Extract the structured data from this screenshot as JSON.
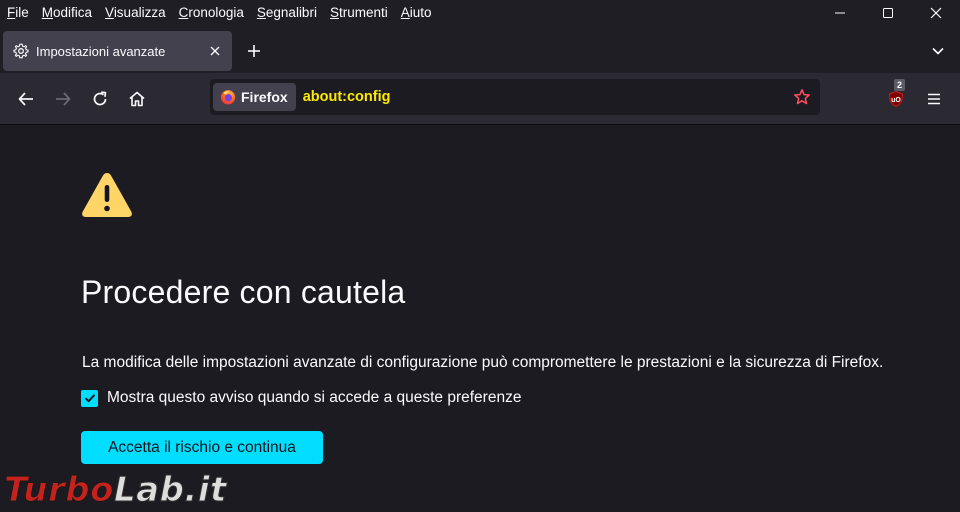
{
  "menubar": {
    "items": [
      {
        "first": "F",
        "rest": "ile"
      },
      {
        "first": "M",
        "rest": "odifica"
      },
      {
        "first": "V",
        "rest": "isualizza"
      },
      {
        "first": "C",
        "rest": "ronologia"
      },
      {
        "first": "S",
        "rest": "egnalibri"
      },
      {
        "first": "S",
        "rest": "trumenti"
      },
      {
        "first": "A",
        "rest": "iuto"
      }
    ]
  },
  "window_controls": {
    "minimize": "—",
    "maximize": "☐",
    "close": "✕"
  },
  "tab": {
    "title": "Impostazioni avanzate",
    "icon": "gear-icon",
    "close": "✕"
  },
  "newtab": {
    "label": "+"
  },
  "urlbar": {
    "identity_label": "Firefox",
    "url": "about:config"
  },
  "extension": {
    "badge": "2"
  },
  "content": {
    "heading": "Procedere con cautela",
    "description": "La modifica delle impostazioni avanzate di configurazione può compromettere le prestazioni e la sicurezza di Firefox.",
    "checkbox_label": "Mostra questo avviso quando si accede a queste preferenze",
    "checkbox_checked": true,
    "accept_button": "Accetta il rischio e continua"
  },
  "watermark": {
    "part1": "Turbo",
    "part2": "Lab.it"
  },
  "colors": {
    "accent": "#00ddff",
    "url_text": "#ffe900",
    "warning": "#ffd567",
    "background": "#1c1b22"
  }
}
